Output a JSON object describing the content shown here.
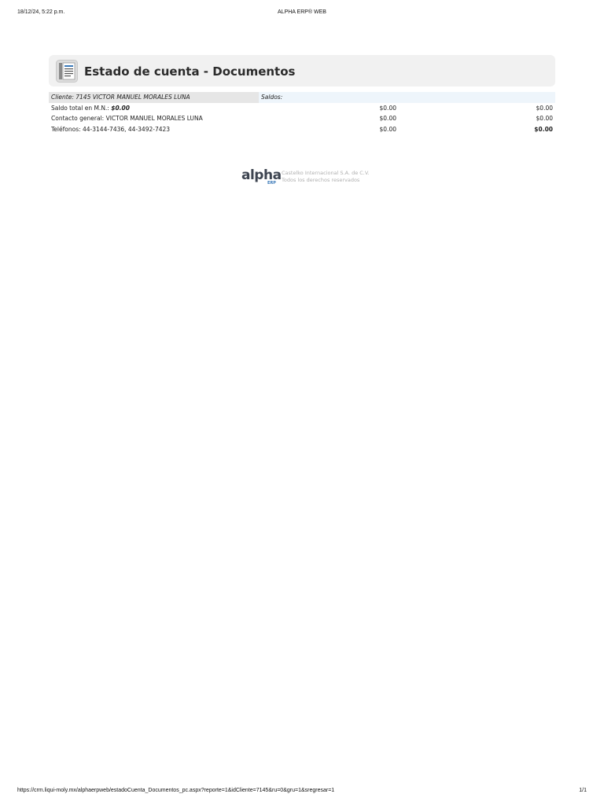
{
  "print_header": {
    "date": "18/12/24, 5:22 p.m.",
    "title": "ALPHA ERP® WEB"
  },
  "report": {
    "title": "Estado de cuenta - Documentos",
    "icon": "document-list-icon"
  },
  "client": {
    "cliente_label": "Cliente:",
    "cliente_value": "7145 VICTOR MANUEL MORALES LUNA",
    "saldos_label": "Saldos:",
    "saldo_total_label": "Saldo total en M.N.:",
    "saldo_total_value": "$0.00",
    "contacto": "Contacto general: VICTOR MANUEL MORALES LUNA",
    "telefonos": "Teléfonos: 44-3144-7436, 44-3492-7423",
    "saldos_col1": [
      "$0.00",
      "$0.00",
      "$0.00"
    ],
    "saldos_col2": [
      "$0.00",
      "$0.00",
      "$0.00"
    ]
  },
  "brand": {
    "logo_text": "alpha",
    "logo_sub": "ERP",
    "company": "Castelko Internacional S.A. de C.V.",
    "rights": "Todos los derechos reservados"
  },
  "print_footer": {
    "url": "https://crm.liqui-moly.mx/alphaerpweb/estadoCuenta_Documentos_pc.aspx?reporte=1&idCliente=7145&ru=0&gru=1&sregresar=1",
    "page": "1/1"
  },
  "colors": {
    "header_bg": "#f1f1f1",
    "client_cell_bg": "#e6e6e6",
    "saldos_head_bg": "#eef5fb",
    "brand_blue": "#3a79b8"
  }
}
